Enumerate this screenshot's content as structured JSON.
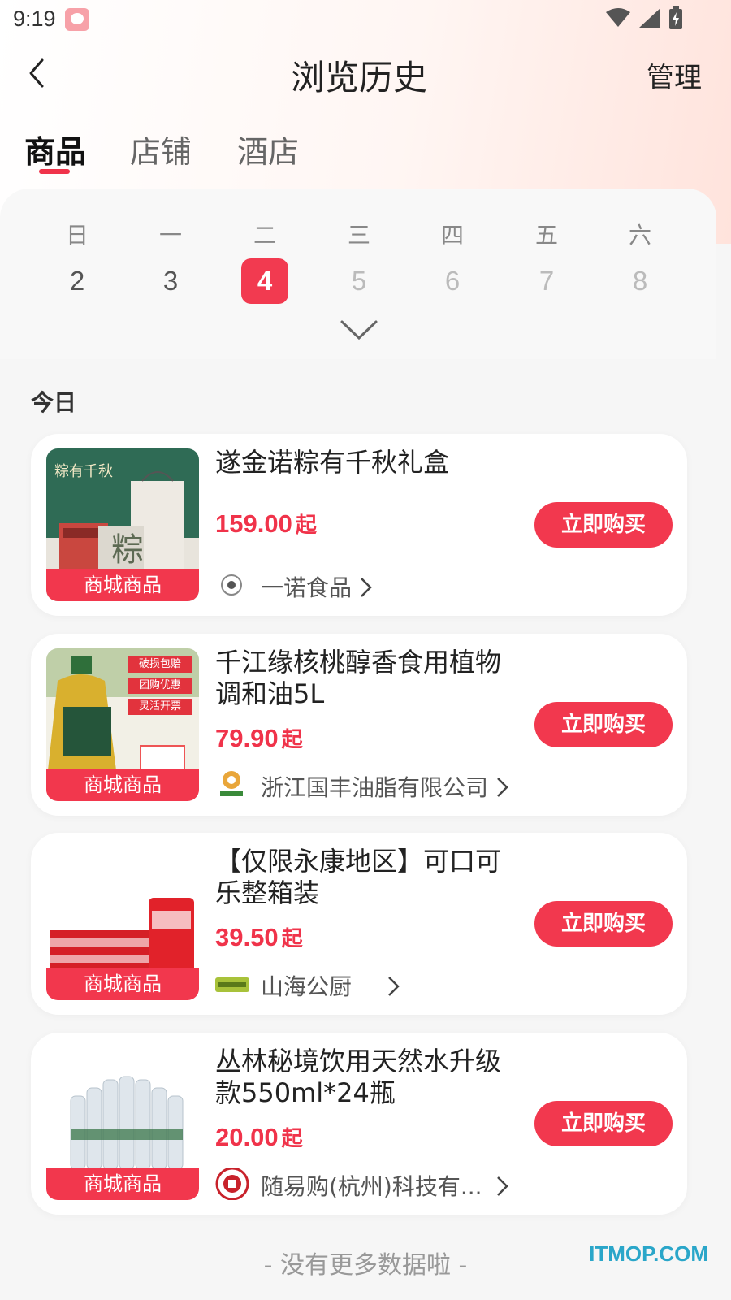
{
  "status_bar": {
    "time": "9:19"
  },
  "header": {
    "title": "浏览历史",
    "manage_label": "管理"
  },
  "tabs": [
    {
      "label": "商品",
      "active": true
    },
    {
      "label": "店铺",
      "active": false
    },
    {
      "label": "酒店",
      "active": false
    }
  ],
  "calendar": {
    "weekdays": [
      "日",
      "一",
      "二",
      "三",
      "四",
      "五",
      "六"
    ],
    "dates": [
      "2",
      "3",
      "4",
      "5",
      "6",
      "7",
      "8"
    ],
    "selected_date": "4"
  },
  "section_label": "今日",
  "products": [
    {
      "title": "遂金诺粽有千秋礼盒",
      "price": "159.00",
      "price_suffix": "起",
      "tag": "商城商品",
      "buy_label": "立即购买",
      "shop_name": "一诺食品",
      "thumb_text": "粽有千秋"
    },
    {
      "title": "千江缘核桃醇香食用植物调和油5L",
      "price": "79.90",
      "price_suffix": "起",
      "tag": "商城商品",
      "buy_label": "立即购买",
      "shop_name": "浙江国丰油脂有限公司",
      "thumb_badges": [
        "破损包赔",
        "团购优惠",
        "灵活开票"
      ]
    },
    {
      "title": "【仅限永康地区】可口可乐整箱装",
      "price": "39.50",
      "price_suffix": "起",
      "tag": "商城商品",
      "buy_label": "立即购买",
      "shop_name": "山海公厨"
    },
    {
      "title": "丛林秘境饮用天然水升级款550ml*24瓶",
      "price": "20.00",
      "price_suffix": "起",
      "tag": "商城商品",
      "buy_label": "立即购买",
      "shop_name": "随易购(杭州)科技有..."
    }
  ],
  "end_text": "- 没有更多数据啦 -",
  "watermark": "ITMOP.COM",
  "colors": {
    "accent": "#f2384e",
    "price": "#f0334a"
  }
}
